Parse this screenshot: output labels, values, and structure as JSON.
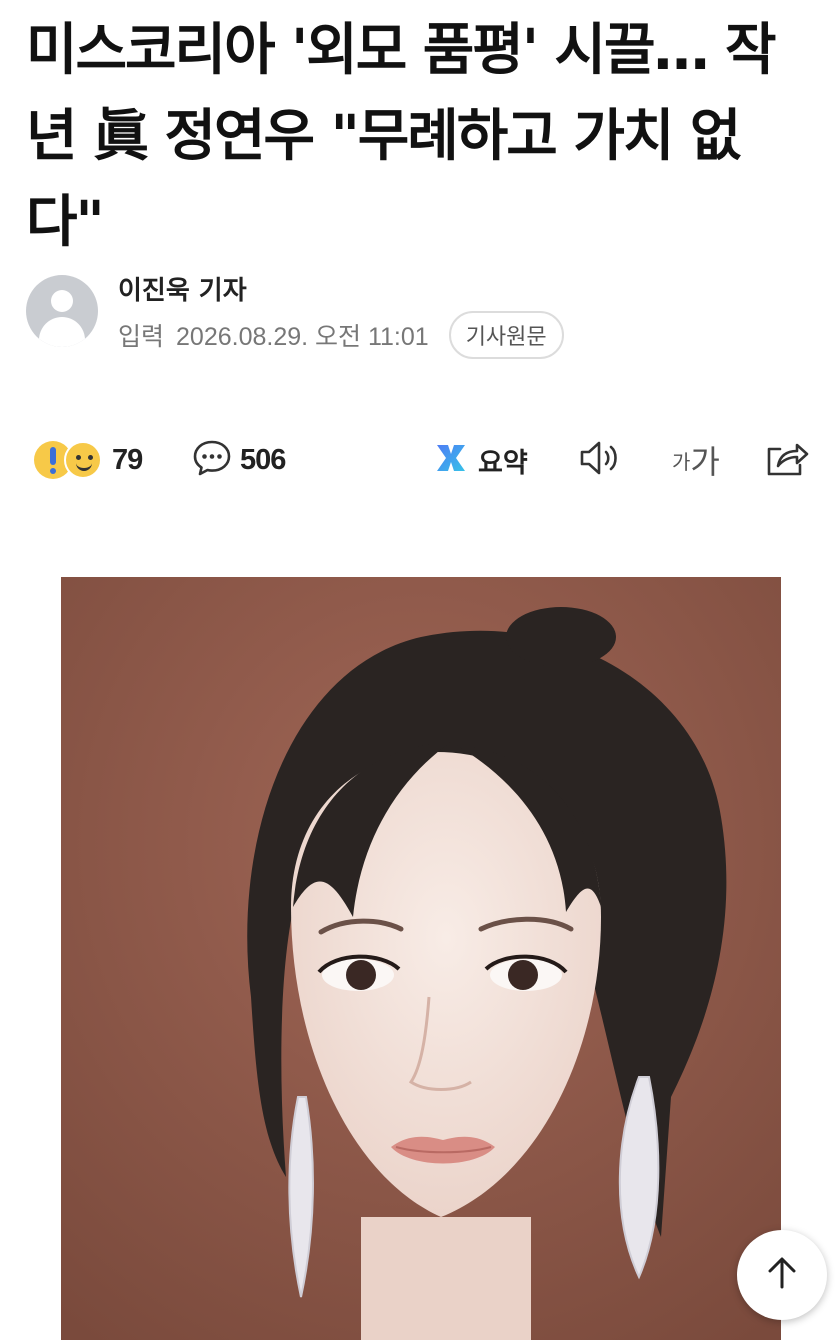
{
  "article": {
    "headline": "미스코리아 '외모 품평' 시끌… 작년 眞 정연우 \"무례하고 가치 없다\""
  },
  "byline": {
    "reporter": "이진욱 기자",
    "date_label": "입력",
    "date_value": "2026.08.29. 오전 11:01",
    "origin_button": "기사원문"
  },
  "toolbar": {
    "reaction_count": "79",
    "comment_count": "506",
    "summary_label": "요약",
    "font_small": "가",
    "font_big": "가",
    "icons": [
      "reaction-emoji-icons",
      "comment-icon",
      "summary-icon",
      "speaker-icon",
      "font-size-icon",
      "share-icon"
    ]
  },
  "photo": {
    "subject": "portrait-photo"
  },
  "floating": {
    "scroll_top_icon": "arrow-up-icon"
  },
  "colors": {
    "summary_gradient": [
      "#4f7df5",
      "#36c2e8"
    ],
    "photo_background": "#8a5848"
  }
}
